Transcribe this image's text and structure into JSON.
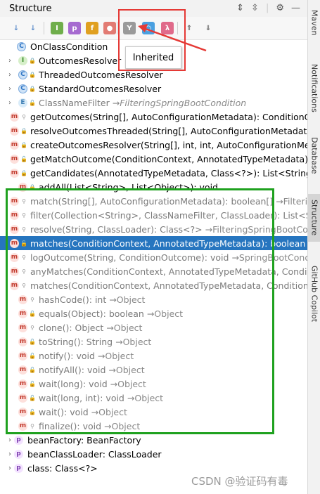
{
  "window": {
    "title": "Structure"
  },
  "tooltip": {
    "text": "Inherited"
  },
  "toolbar": {
    "tools": [
      {
        "name": "sort-by-visibility-icon",
        "glyph": "↓",
        "bg": "#f7f7f7",
        "fg": "#5b8bc9"
      },
      {
        "name": "sort-alphabetically-icon",
        "glyph": "↓",
        "bg": "#f7f7f7",
        "fg": "#5b8bc9"
      },
      {
        "name": "show-interfaces-icon",
        "glyph": "I",
        "bg": "#6fae4b",
        "fg": "#fff"
      },
      {
        "name": "show-properties-icon",
        "glyph": "p",
        "bg": "#a66ad0",
        "fg": "#fff"
      },
      {
        "name": "show-fields-icon",
        "glyph": "f",
        "bg": "#e0a020",
        "fg": "#fff"
      },
      {
        "name": "show-non-public-icon",
        "glyph": "●",
        "bg": "#e27b73",
        "fg": "#fff"
      },
      {
        "name": "show-inherited-icon",
        "glyph": "Y",
        "bg": "#9a9a9a",
        "fg": "#fff"
      },
      {
        "name": "show-anonymous-icon",
        "glyph": "○",
        "bg": "#4aa0e0",
        "fg": "#fff"
      },
      {
        "name": "show-lambdas-icon",
        "glyph": "λ",
        "bg": "#e06a8a",
        "fg": "#fff"
      },
      {
        "name": "expand-all-icon",
        "glyph": "⇑",
        "bg": "#f7f7f7",
        "fg": "#666"
      },
      {
        "name": "collapse-all-icon",
        "glyph": "⇓",
        "bg": "#f7f7f7",
        "fg": "#666"
      }
    ]
  },
  "tree": {
    "rows": [
      {
        "indent": 0,
        "chev": "",
        "icon": "C",
        "kind": "c",
        "vis": "",
        "name": "OnClassCondition",
        "inherited": ""
      },
      {
        "indent": 1,
        "chev": "›",
        "icon": "I",
        "kind": "i",
        "vis": "lock",
        "name": "OutcomesResolver",
        "inherited": ""
      },
      {
        "indent": 1,
        "chev": "›",
        "icon": "C",
        "kind": "c",
        "vis": "lock",
        "name": "ThreadedOutcomesResolver",
        "inherited": ""
      },
      {
        "indent": 1,
        "chev": "›",
        "icon": "C",
        "kind": "c",
        "vis": "lock",
        "name": "StandardOutcomesResolver",
        "inherited": ""
      },
      {
        "indent": 1,
        "chev": "›",
        "icon": "E",
        "kind": "e",
        "vis": "open",
        "name": "ClassNameFilter",
        "inherited": "→FilteringSpringBootCondition",
        "grey": true
      },
      {
        "indent": 1,
        "chev": "",
        "icon": "m",
        "kind": "m",
        "vis": "key",
        "name": "getOutcomes(String[], AutoConfigurationMetadata): ConditionOu",
        "inherited": ""
      },
      {
        "indent": 1,
        "chev": "",
        "icon": "m",
        "kind": "m",
        "vis": "lock",
        "name": "resolveOutcomesThreaded(String[], AutoConfigurationMetadata",
        "inherited": ""
      },
      {
        "indent": 1,
        "chev": "",
        "icon": "m",
        "kind": "m",
        "vis": "lock",
        "name": "createOutcomesResolver(String[], int, int, AutoConfigurationMeta",
        "inherited": ""
      },
      {
        "indent": 1,
        "chev": "",
        "icon": "m",
        "kind": "m",
        "vis": "open",
        "name": "getMatchOutcome(ConditionContext, AnnotatedTypeMetadata):",
        "inherited": ""
      },
      {
        "indent": 1,
        "chev": "",
        "icon": "m",
        "kind": "m",
        "vis": "lock",
        "name": "getCandidates(AnnotatedTypeMetadata, Class<?>): List<String>",
        "inherited": ""
      },
      {
        "indent": 1,
        "chev": "",
        "icon": "m",
        "kind": "m",
        "vis": "lock",
        "name": "addAll(List<String>, List<Object>): void",
        "inherited": ""
      },
      {
        "indent": 1,
        "chev": "",
        "icon": "m",
        "kind": "m",
        "vis": "key",
        "name": "match(String[], AutoConfigurationMetadata): boolean[]",
        "inherited": "→Filtering",
        "grey": true
      },
      {
        "indent": 1,
        "chev": "",
        "icon": "m",
        "kind": "m",
        "vis": "key",
        "name": "filter(Collection<String>, ClassNameFilter, ClassLoader): List<Str",
        "inherited": "",
        "grey": true
      },
      {
        "indent": 1,
        "chev": "",
        "icon": "m",
        "kind": "m",
        "vis": "key",
        "name": "resolve(String, ClassLoader): Class<?>",
        "inherited": "→FilteringSpringBootCon",
        "grey": true
      },
      {
        "indent": 1,
        "chev": "",
        "icon": "m",
        "kind": "m",
        "vis": "open",
        "name": "matches(ConditionContext, AnnotatedTypeMetadata): boolean",
        "inherited": "→",
        "selected": true
      },
      {
        "indent": 1,
        "chev": "",
        "icon": "m",
        "kind": "m",
        "vis": "key",
        "name": "logOutcome(String, ConditionOutcome): void",
        "inherited": "→SpringBootCond",
        "grey": true
      },
      {
        "indent": 1,
        "chev": "",
        "icon": "m",
        "kind": "m",
        "vis": "key",
        "name": "anyMatches(ConditionContext, AnnotatedTypeMetadata, Conditio",
        "inherited": "",
        "grey": true
      },
      {
        "indent": 1,
        "chev": "",
        "icon": "m",
        "kind": "m",
        "vis": "key",
        "name": "matches(ConditionContext, AnnotatedTypeMetadata, Condition):",
        "inherited": "",
        "grey": true
      },
      {
        "indent": 1,
        "chev": "",
        "icon": "m",
        "kind": "m",
        "vis": "key",
        "name": "hashCode(): int",
        "inherited": "→Object",
        "grey": true
      },
      {
        "indent": 1,
        "chev": "",
        "icon": "m",
        "kind": "m",
        "vis": "open",
        "name": "equals(Object): boolean",
        "inherited": "→Object",
        "grey": true
      },
      {
        "indent": 1,
        "chev": "",
        "icon": "m",
        "kind": "m",
        "vis": "key",
        "name": "clone(): Object",
        "inherited": "→Object",
        "grey": true
      },
      {
        "indent": 1,
        "chev": "",
        "icon": "m",
        "kind": "m",
        "vis": "open",
        "name": "toString(): String",
        "inherited": "→Object",
        "grey": true
      },
      {
        "indent": 1,
        "chev": "",
        "icon": "m",
        "kind": "m",
        "vis": "open",
        "name": "notify(): void",
        "inherited": "→Object",
        "grey": true
      },
      {
        "indent": 1,
        "chev": "",
        "icon": "m",
        "kind": "m",
        "vis": "open",
        "name": "notifyAll(): void",
        "inherited": "→Object",
        "grey": true
      },
      {
        "indent": 1,
        "chev": "",
        "icon": "m",
        "kind": "m",
        "vis": "open",
        "name": "wait(long): void",
        "inherited": "→Object",
        "grey": true
      },
      {
        "indent": 1,
        "chev": "",
        "icon": "m",
        "kind": "m",
        "vis": "open",
        "name": "wait(long, int): void",
        "inherited": "→Object",
        "grey": true
      },
      {
        "indent": 1,
        "chev": "",
        "icon": "m",
        "kind": "m",
        "vis": "open",
        "name": "wait(): void",
        "inherited": "→Object",
        "grey": true
      },
      {
        "indent": 1,
        "chev": "",
        "icon": "m",
        "kind": "m",
        "vis": "key",
        "name": "finalize(): void",
        "inherited": "→Object",
        "grey": true
      },
      {
        "indent": 0,
        "chev": "›",
        "icon": "p",
        "kind": "p",
        "vis": "",
        "name": "beanFactory: BeanFactory",
        "inherited": ""
      },
      {
        "indent": 0,
        "chev": "›",
        "icon": "p",
        "kind": "p",
        "vis": "",
        "name": "beanClassLoader: ClassLoader",
        "inherited": ""
      },
      {
        "indent": 0,
        "chev": "›",
        "icon": "p",
        "kind": "p",
        "vis": "",
        "name": "class: Class<?>",
        "inherited": ""
      }
    ]
  },
  "sidebar": {
    "tabs": [
      {
        "label": "Maven",
        "icon": "m"
      },
      {
        "label": "Notifications",
        "icon": "🔔"
      },
      {
        "label": "Database",
        "icon": "▤"
      },
      {
        "label": "Structure",
        "icon": "▦",
        "active": true
      },
      {
        "label": "GitHub Copilot",
        "icon": "◎"
      }
    ]
  },
  "watermark": "CSDN @验证码有毒"
}
